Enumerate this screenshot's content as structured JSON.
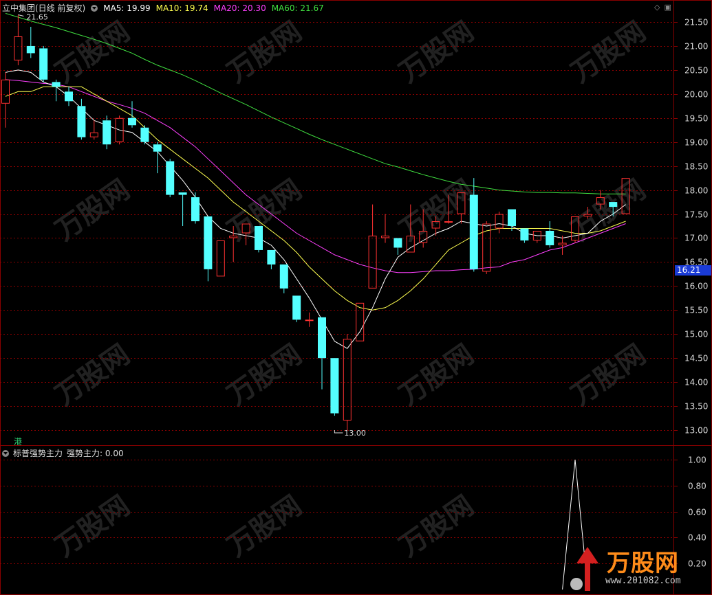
{
  "header": {
    "stock_title": "立中集团(日线 前复权)",
    "ma5": "MA5: 19.99",
    "ma10": "MA10: 19.74",
    "ma20": "MA20: 20.30",
    "ma60": "MA60: 21.67"
  },
  "indicator_header": {
    "name": "标普强势主力",
    "value": "强势主力: 0.00"
  },
  "market_badge": "港",
  "current_price_tag": "16.21",
  "annotations": {
    "high": "21.65",
    "low": "13.00"
  },
  "logo": {
    "text": "万股网",
    "url": "www.201082.com"
  },
  "colors": {
    "up": "#ff3232",
    "down": "#54ffff",
    "ma5": "#ffffff",
    "ma10": "#ffff50",
    "ma20": "#ff40ff",
    "ma60": "#40e040",
    "grid": "#8b0000"
  },
  "chart_data": [
    {
      "type": "candlestick",
      "yticks": [
        "21.50",
        "21.00",
        "20.50",
        "20.00",
        "19.50",
        "19.00",
        "18.50",
        "18.00",
        "17.50",
        "17.00",
        "16.50",
        "16.00",
        "15.50",
        "15.00",
        "14.50",
        "14.00",
        "13.50",
        "13.00"
      ],
      "ylim": [
        12.8,
        21.75
      ],
      "candles": [
        [
          19.8,
          20.3,
          19.3,
          20.45
        ],
        [
          20.7,
          21.2,
          20.6,
          21.65
        ],
        [
          21.0,
          20.85,
          20.75,
          21.4
        ],
        [
          20.95,
          20.3,
          20.25,
          21.0
        ],
        [
          20.25,
          20.15,
          19.85,
          20.3
        ],
        [
          20.05,
          19.85,
          19.75,
          20.15
        ],
        [
          19.75,
          19.1,
          19.05,
          19.9
        ],
        [
          19.1,
          19.2,
          19.05,
          19.45
        ],
        [
          19.45,
          18.95,
          18.85,
          19.55
        ],
        [
          19.0,
          19.5,
          18.95,
          19.55
        ],
        [
          19.5,
          19.35,
          19.3,
          19.85
        ],
        [
          19.3,
          19.0,
          18.95,
          19.35
        ],
        [
          18.95,
          18.8,
          18.35,
          19.0
        ],
        [
          18.6,
          17.9,
          17.85,
          18.65
        ],
        [
          17.95,
          17.9,
          17.25,
          17.95
        ],
        [
          17.85,
          17.35,
          17.3,
          17.95
        ],
        [
          17.45,
          16.35,
          16.1,
          17.45
        ],
        [
          16.2,
          16.95,
          16.2,
          16.95
        ],
        [
          17.0,
          17.05,
          16.5,
          17.25
        ],
        [
          17.1,
          17.3,
          16.85,
          17.3
        ],
        [
          17.25,
          16.75,
          16.7,
          17.25
        ],
        [
          16.75,
          16.45,
          16.35,
          16.75
        ],
        [
          16.45,
          15.95,
          15.85,
          16.45
        ],
        [
          15.8,
          15.3,
          15.25,
          15.8
        ],
        [
          15.3,
          15.3,
          15.15,
          15.45
        ],
        [
          15.35,
          14.5,
          13.85,
          15.35
        ],
        [
          14.5,
          13.35,
          13.3,
          14.5
        ],
        [
          13.2,
          14.9,
          13.0,
          15.0
        ],
        [
          14.85,
          15.65,
          14.85,
          15.65
        ],
        [
          15.95,
          17.05,
          15.95,
          17.7
        ],
        [
          17.0,
          17.05,
          16.9,
          17.5
        ],
        [
          17.0,
          16.8,
          16.65,
          17.0
        ],
        [
          16.7,
          17.05,
          16.7,
          17.7
        ],
        [
          16.9,
          17.15,
          16.8,
          17.6
        ],
        [
          17.2,
          17.35,
          17.05,
          17.45
        ],
        [
          17.35,
          17.35,
          17.3,
          17.9
        ],
        [
          17.5,
          17.95,
          17.3,
          17.95
        ],
        [
          17.9,
          16.35,
          16.3,
          18.25
        ],
        [
          16.3,
          17.3,
          16.25,
          17.35
        ],
        [
          17.2,
          17.5,
          17.1,
          17.55
        ],
        [
          17.6,
          17.25,
          17.15,
          17.6
        ],
        [
          17.2,
          16.95,
          16.9,
          17.2
        ],
        [
          16.95,
          17.15,
          16.9,
          17.15
        ],
        [
          17.15,
          16.85,
          16.8,
          17.35
        ],
        [
          16.85,
          16.9,
          16.65,
          17.05
        ],
        [
          16.95,
          17.45,
          16.9,
          17.45
        ],
        [
          17.45,
          17.5,
          17.4,
          17.65
        ],
        [
          17.7,
          17.85,
          17.6,
          18.0
        ],
        [
          17.75,
          17.65,
          17.45,
          17.75
        ],
        [
          17.5,
          18.25,
          17.5,
          18.25
        ]
      ],
      "ma5": [
        20.45,
        20.5,
        20.45,
        20.25,
        20.15,
        19.95,
        19.7,
        19.45,
        19.35,
        19.25,
        19.2,
        19.0,
        18.8,
        18.5,
        18.2,
        17.85,
        17.45,
        17.2,
        17.1,
        17.05,
        17.0,
        16.85,
        16.55,
        16.15,
        15.75,
        15.3,
        14.85,
        14.7,
        15.05,
        15.55,
        16.15,
        16.6,
        16.8,
        16.95,
        17.1,
        17.2,
        17.35,
        17.3,
        17.25,
        17.3,
        17.25,
        17.1,
        17.05,
        17.05,
        17.0,
        17.05,
        17.1,
        17.35,
        17.5,
        17.7
      ],
      "ma10": [
        19.95,
        20.05,
        20.05,
        20.15,
        20.15,
        20.15,
        20.15,
        20.0,
        19.85,
        19.7,
        19.55,
        19.3,
        19.05,
        18.85,
        18.65,
        18.45,
        18.25,
        18.0,
        17.75,
        17.55,
        17.35,
        17.15,
        16.95,
        16.7,
        16.4,
        16.15,
        15.9,
        15.7,
        15.55,
        15.5,
        15.55,
        15.7,
        15.9,
        16.15,
        16.45,
        16.75,
        16.9,
        17.05,
        17.15,
        17.2,
        17.2,
        17.2,
        17.2,
        17.2,
        17.15,
        17.1,
        17.1,
        17.15,
        17.25,
        17.35
      ],
      "ma20": [
        20.3,
        20.28,
        20.25,
        20.22,
        20.2,
        20.15,
        20.05,
        19.95,
        19.85,
        19.78,
        19.7,
        19.6,
        19.45,
        19.3,
        19.1,
        18.9,
        18.65,
        18.4,
        18.15,
        17.9,
        17.7,
        17.5,
        17.3,
        17.1,
        16.95,
        16.8,
        16.65,
        16.55,
        16.45,
        16.38,
        16.32,
        16.28,
        16.28,
        16.3,
        16.32,
        16.32,
        16.34,
        16.35,
        16.38,
        16.4,
        16.5,
        16.55,
        16.65,
        16.75,
        16.8,
        16.9,
        17.0,
        17.1,
        17.2,
        17.3
      ],
      "ma60": [
        21.68,
        21.6,
        21.52,
        21.45,
        21.38,
        21.3,
        21.22,
        21.14,
        21.05,
        20.95,
        20.85,
        20.72,
        20.6,
        20.5,
        20.4,
        20.28,
        20.15,
        20.02,
        19.9,
        19.78,
        19.65,
        19.52,
        19.4,
        19.28,
        19.16,
        19.05,
        18.95,
        18.85,
        18.75,
        18.65,
        18.55,
        18.48,
        18.4,
        18.32,
        18.25,
        18.18,
        18.12,
        18.08,
        18.04,
        18.0,
        17.98,
        17.96,
        17.95,
        17.95,
        17.94,
        17.94,
        17.93,
        17.92,
        17.92,
        17.92
      ]
    },
    {
      "type": "line",
      "name": "强势主力",
      "yticks": [
        "1.00",
        "0.80",
        "0.60",
        "0.40",
        "0.20"
      ],
      "ylim": [
        0,
        1.05
      ],
      "values": [
        0,
        0,
        0,
        0,
        0,
        0,
        0,
        0,
        0,
        0,
        0,
        0,
        0,
        0,
        0,
        0,
        0,
        0,
        0,
        0,
        0,
        0,
        0,
        0,
        0,
        0,
        0,
        0,
        0,
        0,
        0,
        0,
        0,
        0,
        0,
        0,
        0,
        0,
        0,
        0,
        0,
        0,
        0,
        0,
        0,
        1,
        0,
        0,
        0,
        0
      ]
    }
  ]
}
